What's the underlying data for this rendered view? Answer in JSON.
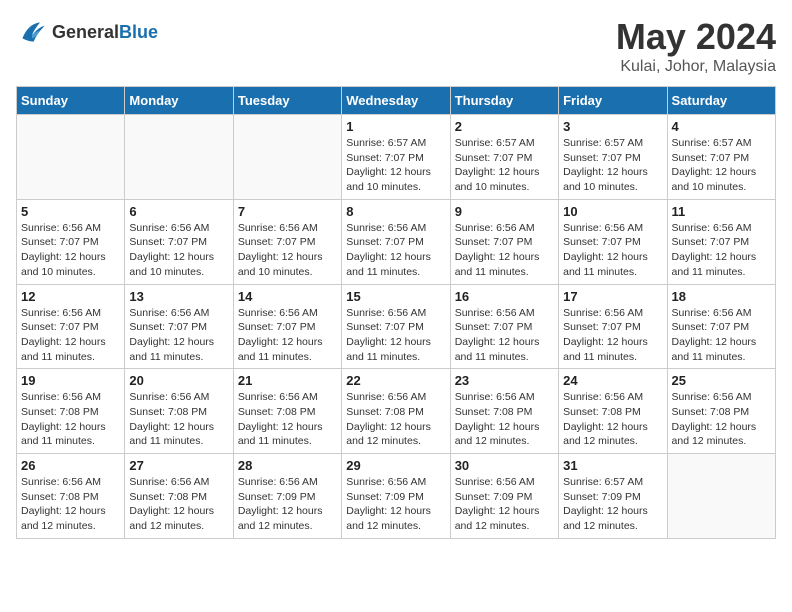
{
  "header": {
    "logo_general": "General",
    "logo_blue": "Blue",
    "month": "May 2024",
    "location": "Kulai, Johor, Malaysia"
  },
  "weekdays": [
    "Sunday",
    "Monday",
    "Tuesday",
    "Wednesday",
    "Thursday",
    "Friday",
    "Saturday"
  ],
  "weeks": [
    [
      {
        "day": "",
        "info": ""
      },
      {
        "day": "",
        "info": ""
      },
      {
        "day": "",
        "info": ""
      },
      {
        "day": "1",
        "info": "Sunrise: 6:57 AM\nSunset: 7:07 PM\nDaylight: 12 hours\nand 10 minutes."
      },
      {
        "day": "2",
        "info": "Sunrise: 6:57 AM\nSunset: 7:07 PM\nDaylight: 12 hours\nand 10 minutes."
      },
      {
        "day": "3",
        "info": "Sunrise: 6:57 AM\nSunset: 7:07 PM\nDaylight: 12 hours\nand 10 minutes."
      },
      {
        "day": "4",
        "info": "Sunrise: 6:57 AM\nSunset: 7:07 PM\nDaylight: 12 hours\nand 10 minutes."
      }
    ],
    [
      {
        "day": "5",
        "info": "Sunrise: 6:56 AM\nSunset: 7:07 PM\nDaylight: 12 hours\nand 10 minutes."
      },
      {
        "day": "6",
        "info": "Sunrise: 6:56 AM\nSunset: 7:07 PM\nDaylight: 12 hours\nand 10 minutes."
      },
      {
        "day": "7",
        "info": "Sunrise: 6:56 AM\nSunset: 7:07 PM\nDaylight: 12 hours\nand 10 minutes."
      },
      {
        "day": "8",
        "info": "Sunrise: 6:56 AM\nSunset: 7:07 PM\nDaylight: 12 hours\nand 11 minutes."
      },
      {
        "day": "9",
        "info": "Sunrise: 6:56 AM\nSunset: 7:07 PM\nDaylight: 12 hours\nand 11 minutes."
      },
      {
        "day": "10",
        "info": "Sunrise: 6:56 AM\nSunset: 7:07 PM\nDaylight: 12 hours\nand 11 minutes."
      },
      {
        "day": "11",
        "info": "Sunrise: 6:56 AM\nSunset: 7:07 PM\nDaylight: 12 hours\nand 11 minutes."
      }
    ],
    [
      {
        "day": "12",
        "info": "Sunrise: 6:56 AM\nSunset: 7:07 PM\nDaylight: 12 hours\nand 11 minutes."
      },
      {
        "day": "13",
        "info": "Sunrise: 6:56 AM\nSunset: 7:07 PM\nDaylight: 12 hours\nand 11 minutes."
      },
      {
        "day": "14",
        "info": "Sunrise: 6:56 AM\nSunset: 7:07 PM\nDaylight: 12 hours\nand 11 minutes."
      },
      {
        "day": "15",
        "info": "Sunrise: 6:56 AM\nSunset: 7:07 PM\nDaylight: 12 hours\nand 11 minutes."
      },
      {
        "day": "16",
        "info": "Sunrise: 6:56 AM\nSunset: 7:07 PM\nDaylight: 12 hours\nand 11 minutes."
      },
      {
        "day": "17",
        "info": "Sunrise: 6:56 AM\nSunset: 7:07 PM\nDaylight: 12 hours\nand 11 minutes."
      },
      {
        "day": "18",
        "info": "Sunrise: 6:56 AM\nSunset: 7:07 PM\nDaylight: 12 hours\nand 11 minutes."
      }
    ],
    [
      {
        "day": "19",
        "info": "Sunrise: 6:56 AM\nSunset: 7:08 PM\nDaylight: 12 hours\nand 11 minutes."
      },
      {
        "day": "20",
        "info": "Sunrise: 6:56 AM\nSunset: 7:08 PM\nDaylight: 12 hours\nand 11 minutes."
      },
      {
        "day": "21",
        "info": "Sunrise: 6:56 AM\nSunset: 7:08 PM\nDaylight: 12 hours\nand 11 minutes."
      },
      {
        "day": "22",
        "info": "Sunrise: 6:56 AM\nSunset: 7:08 PM\nDaylight: 12 hours\nand 12 minutes."
      },
      {
        "day": "23",
        "info": "Sunrise: 6:56 AM\nSunset: 7:08 PM\nDaylight: 12 hours\nand 12 minutes."
      },
      {
        "day": "24",
        "info": "Sunrise: 6:56 AM\nSunset: 7:08 PM\nDaylight: 12 hours\nand 12 minutes."
      },
      {
        "day": "25",
        "info": "Sunrise: 6:56 AM\nSunset: 7:08 PM\nDaylight: 12 hours\nand 12 minutes."
      }
    ],
    [
      {
        "day": "26",
        "info": "Sunrise: 6:56 AM\nSunset: 7:08 PM\nDaylight: 12 hours\nand 12 minutes."
      },
      {
        "day": "27",
        "info": "Sunrise: 6:56 AM\nSunset: 7:08 PM\nDaylight: 12 hours\nand 12 minutes."
      },
      {
        "day": "28",
        "info": "Sunrise: 6:56 AM\nSunset: 7:09 PM\nDaylight: 12 hours\nand 12 minutes."
      },
      {
        "day": "29",
        "info": "Sunrise: 6:56 AM\nSunset: 7:09 PM\nDaylight: 12 hours\nand 12 minutes."
      },
      {
        "day": "30",
        "info": "Sunrise: 6:56 AM\nSunset: 7:09 PM\nDaylight: 12 hours\nand 12 minutes."
      },
      {
        "day": "31",
        "info": "Sunrise: 6:57 AM\nSunset: 7:09 PM\nDaylight: 12 hours\nand 12 minutes."
      },
      {
        "day": "",
        "info": ""
      }
    ]
  ]
}
